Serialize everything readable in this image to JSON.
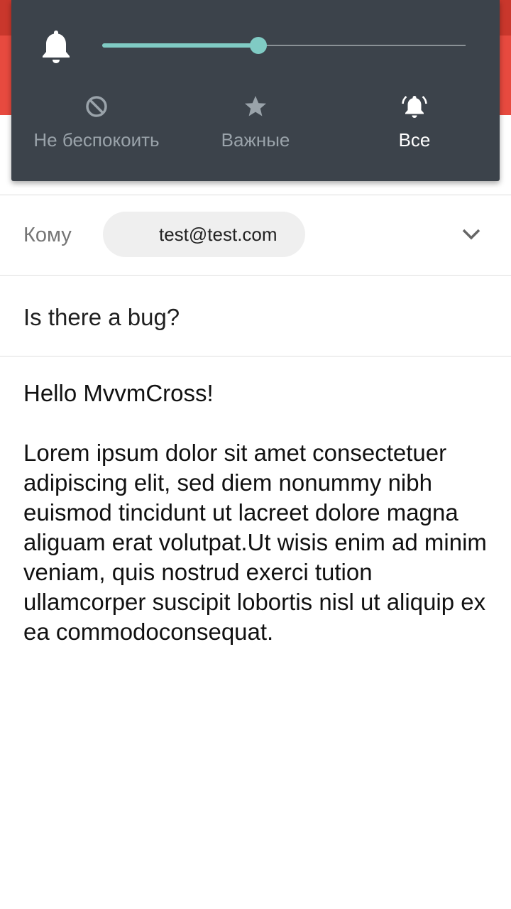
{
  "volume_panel": {
    "level_fraction": 0.43,
    "accent_color": "#80cbc4",
    "modes": [
      {
        "label": "Не беспокоить",
        "icon": "do-not-disturb-icon",
        "active": false
      },
      {
        "label": "Важные",
        "icon": "star-icon",
        "active": false
      },
      {
        "label": "Все",
        "icon": "bell-ringing-icon",
        "active": true
      }
    ]
  },
  "compose": {
    "to_label": "Кому",
    "to_value": "test@test.com",
    "subject": "Is there a bug?",
    "body": "Hello MvvmCross!\n\nLorem ipsum dolor sit amet consectetuer adipiscing elit, sed diem nonummy nibh euismod tincidunt ut lacreet dolore magna aliguam erat volutpat.Ut wisis enim ad minim veniam, quis nostrud exerci tution ullamcorper suscipit lobortis nisl ut aliquip ex ea commodoconsequat."
  },
  "colors": {
    "header_red": "#e74a3f",
    "panel_bg": "#3c434b"
  }
}
